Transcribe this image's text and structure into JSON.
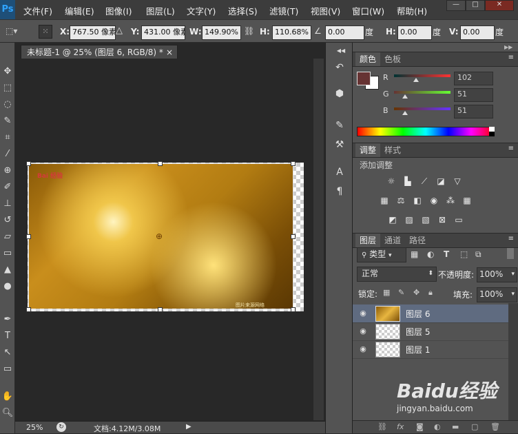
{
  "menubar": {
    "logo": "Ps",
    "items": [
      "文件(F)",
      "编辑(E)",
      "图像(I)",
      "图层(L)",
      "文字(Y)",
      "选择(S)",
      "滤镜(T)",
      "视图(V)",
      "窗口(W)",
      "帮助(H)"
    ],
    "window_buttons": [
      "—",
      "□",
      "✕"
    ]
  },
  "options": {
    "x_label": "X:",
    "x_value": "767.50 像素",
    "y_label": "Y:",
    "y_value": "431.00 像素",
    "w_label": "W:",
    "w_value": "149.90%",
    "h_label": "H:",
    "h_value": "110.68%",
    "angle_value": "0.00",
    "angle_unit": "度",
    "hskew_label": "H:",
    "hskew_value": "0.00",
    "hskew_unit": "度",
    "vskew_label": "V:",
    "vskew_value": "0.00",
    "vskew_unit": "度"
  },
  "document": {
    "tab_title": "未标题-1 @ 25% (图层 6, RGB/8) *",
    "close": "×",
    "canvas_watermark": "Bai 经验",
    "canvas_footer_text": "图片来源网络"
  },
  "status": {
    "zoom": "25%",
    "doc_info": "文档:4.12M/3.08M"
  },
  "panels": {
    "color_tabs": [
      "颜色",
      "色板"
    ],
    "rgb": [
      {
        "label": "R",
        "value": "102"
      },
      {
        "label": "G",
        "value": "51"
      },
      {
        "label": "B",
        "value": "51"
      }
    ],
    "adjust_tabs": [
      "调整",
      "样式"
    ],
    "adjust_title": "添加调整",
    "layers_tabs": [
      "图层",
      "通道",
      "路径"
    ],
    "filter_label": "类型",
    "blend_mode": "正常",
    "opacity_label": "不透明度:",
    "opacity_value": "100%",
    "lock_label": "锁定:",
    "fill_label": "填充:",
    "fill_value": "100%",
    "layers": [
      {
        "name": "图层 6"
      },
      {
        "name": "图层 5"
      },
      {
        "name": "图层 1"
      }
    ]
  },
  "watermark": {
    "brand": "Baidu经验",
    "url": "jingyan.baidu.com"
  },
  "colors": {
    "foreground": "#663333",
    "accent": "#1e4f78"
  }
}
